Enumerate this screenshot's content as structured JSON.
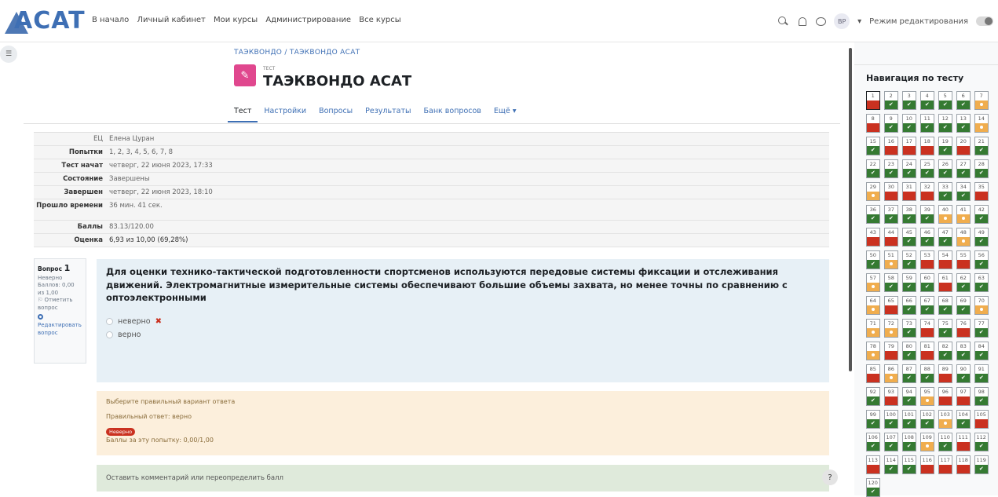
{
  "logo": {
    "text": "ACAT"
  },
  "top_menu": [
    "В начало",
    "Личный кабинет",
    "Мои курсы",
    "Администрирование",
    "Все курсы"
  ],
  "user": {
    "initials": "ВР"
  },
  "edit_mode_label": "Режим редактирования",
  "breadcrumb": "ТАЭКВОНДО / ТАЭКВОНДО АСАТ",
  "quiz": {
    "type_label": "ТЕСТ",
    "title": "ТАЭКВОНДО АСАТ"
  },
  "tabs": [
    "Тест",
    "Настройки",
    "Вопросы",
    "Результаты",
    "Банк вопросов",
    "Ещё ▾"
  ],
  "summary": {
    "user_initials": "ЕЦ",
    "user_name": "Елена Цуран",
    "rows": [
      {
        "label": "Попытки",
        "value": "1, 2, 3, 4, 5, 6, 7, 8"
      },
      {
        "label": "Тест начат",
        "value": "четверг, 22 июня 2023, 17:33"
      },
      {
        "label": "Состояние",
        "value": "Завершены"
      },
      {
        "label": "Завершен",
        "value": "четверг, 22 июня 2023, 18:10"
      },
      {
        "label": "Прошло времени",
        "value": "36 мин. 41 сек."
      },
      {
        "label": "Баллы",
        "value": "83.13/120.00"
      },
      {
        "label": "Оценка",
        "value": "6,93 из 10,00 (69,28%)"
      }
    ]
  },
  "question_info": {
    "prefix": "Вопрос",
    "number": "1",
    "status": "Неверно",
    "points": "Баллов: 0,00 из 1,00",
    "flag": "Отметить вопрос",
    "edit": "Редактировать вопрос"
  },
  "question": {
    "text": "Для оценки технико-тактической подготовленности спортсменов используются передовые системы фиксации и отслеживания движений. Электромагнитные измерительные системы обеспечивают большие объемы захвата, но менее точны по сравнению с оптоэлектронными",
    "options": [
      "неверно",
      "верно"
    ]
  },
  "feedback": {
    "prompt": "Выберите правильный вариант ответа",
    "correct_answer": "Правильный ответ: верно",
    "badge": "Неверно",
    "attempt_points": "Баллы за эту попытку: 0,00/1,00"
  },
  "comment_label": "Оставить комментарий или переопределить балл",
  "help_label": "?",
  "nav": {
    "title": "Навигация по тесту",
    "questions": [
      {
        "n": "1",
        "s": "wrong"
      },
      {
        "n": "2",
        "s": "correct"
      },
      {
        "n": "3",
        "s": "correct"
      },
      {
        "n": "4",
        "s": "correct"
      },
      {
        "n": "5",
        "s": "correct"
      },
      {
        "n": "6",
        "s": "correct"
      },
      {
        "n": "7",
        "s": "partial"
      },
      {
        "n": "8",
        "s": "wrong"
      },
      {
        "n": "9",
        "s": "correct"
      },
      {
        "n": "10",
        "s": "correct"
      },
      {
        "n": "11",
        "s": "correct"
      },
      {
        "n": "12",
        "s": "correct"
      },
      {
        "n": "13",
        "s": "correct"
      },
      {
        "n": "14",
        "s": "partial"
      },
      {
        "n": "15",
        "s": "correct"
      },
      {
        "n": "16",
        "s": "wrong"
      },
      {
        "n": "17",
        "s": "wrong"
      },
      {
        "n": "18",
        "s": "wrong"
      },
      {
        "n": "19",
        "s": "correct"
      },
      {
        "n": "20",
        "s": "wrong"
      },
      {
        "n": "21",
        "s": "correct"
      },
      {
        "n": "22",
        "s": "correct"
      },
      {
        "n": "23",
        "s": "correct"
      },
      {
        "n": "24",
        "s": "correct"
      },
      {
        "n": "25",
        "s": "correct"
      },
      {
        "n": "26",
        "s": "correct"
      },
      {
        "n": "27",
        "s": "correct"
      },
      {
        "n": "28",
        "s": "correct"
      },
      {
        "n": "29",
        "s": "partial"
      },
      {
        "n": "30",
        "s": "wrong"
      },
      {
        "n": "31",
        "s": "wrong"
      },
      {
        "n": "32",
        "s": "wrong"
      },
      {
        "n": "33",
        "s": "correct"
      },
      {
        "n": "34",
        "s": "correct"
      },
      {
        "n": "35",
        "s": "wrong"
      },
      {
        "n": "36",
        "s": "correct"
      },
      {
        "n": "37",
        "s": "correct"
      },
      {
        "n": "38",
        "s": "correct"
      },
      {
        "n": "39",
        "s": "correct"
      },
      {
        "n": "40",
        "s": "partial"
      },
      {
        "n": "41",
        "s": "partial"
      },
      {
        "n": "42",
        "s": "correct"
      },
      {
        "n": "43",
        "s": "wrong"
      },
      {
        "n": "44",
        "s": "wrong"
      },
      {
        "n": "45",
        "s": "correct"
      },
      {
        "n": "46",
        "s": "correct"
      },
      {
        "n": "47",
        "s": "correct"
      },
      {
        "n": "48",
        "s": "partial"
      },
      {
        "n": "49",
        "s": "correct"
      },
      {
        "n": "50",
        "s": "correct"
      },
      {
        "n": "51",
        "s": "partial"
      },
      {
        "n": "52",
        "s": "correct"
      },
      {
        "n": "53",
        "s": "wrong"
      },
      {
        "n": "54",
        "s": "wrong"
      },
      {
        "n": "55",
        "s": "wrong"
      },
      {
        "n": "56",
        "s": "correct"
      },
      {
        "n": "57",
        "s": "partial"
      },
      {
        "n": "58",
        "s": "correct"
      },
      {
        "n": "59",
        "s": "correct"
      },
      {
        "n": "60",
        "s": "correct"
      },
      {
        "n": "61",
        "s": "wrong"
      },
      {
        "n": "62",
        "s": "correct"
      },
      {
        "n": "63",
        "s": "correct"
      },
      {
        "n": "64",
        "s": "partial"
      },
      {
        "n": "65",
        "s": "wrong"
      },
      {
        "n": "66",
        "s": "correct"
      },
      {
        "n": "67",
        "s": "correct"
      },
      {
        "n": "68",
        "s": "correct"
      },
      {
        "n": "69",
        "s": "correct"
      },
      {
        "n": "70",
        "s": "partial"
      },
      {
        "n": "71",
        "s": "partial"
      },
      {
        "n": "72",
        "s": "partial"
      },
      {
        "n": "73",
        "s": "correct"
      },
      {
        "n": "74",
        "s": "wrong"
      },
      {
        "n": "75",
        "s": "correct"
      },
      {
        "n": "76",
        "s": "wrong"
      },
      {
        "n": "77",
        "s": "correct"
      },
      {
        "n": "78",
        "s": "partial"
      },
      {
        "n": "79",
        "s": "wrong"
      },
      {
        "n": "80",
        "s": "correct"
      },
      {
        "n": "81",
        "s": "wrong"
      },
      {
        "n": "82",
        "s": "correct"
      },
      {
        "n": "83",
        "s": "correct"
      },
      {
        "n": "84",
        "s": "correct"
      },
      {
        "n": "85",
        "s": "wrong"
      },
      {
        "n": "86",
        "s": "partial"
      },
      {
        "n": "87",
        "s": "correct"
      },
      {
        "n": "88",
        "s": "correct"
      },
      {
        "n": "89",
        "s": "wrong"
      },
      {
        "n": "90",
        "s": "correct"
      },
      {
        "n": "91",
        "s": "correct"
      },
      {
        "n": "92",
        "s": "correct"
      },
      {
        "n": "93",
        "s": "wrong"
      },
      {
        "n": "94",
        "s": "correct"
      },
      {
        "n": "95",
        "s": "partial"
      },
      {
        "n": "96",
        "s": "wrong"
      },
      {
        "n": "97",
        "s": "wrong"
      },
      {
        "n": "98",
        "s": "correct"
      },
      {
        "n": "99",
        "s": "correct"
      },
      {
        "n": "100",
        "s": "correct"
      },
      {
        "n": "101",
        "s": "correct"
      },
      {
        "n": "102",
        "s": "correct"
      },
      {
        "n": "103",
        "s": "partial"
      },
      {
        "n": "104",
        "s": "correct"
      },
      {
        "n": "105",
        "s": "wrong"
      },
      {
        "n": "106",
        "s": "correct"
      },
      {
        "n": "107",
        "s": "correct"
      },
      {
        "n": "108",
        "s": "correct"
      },
      {
        "n": "109",
        "s": "partial"
      },
      {
        "n": "110",
        "s": "correct"
      },
      {
        "n": "111",
        "s": "wrong"
      },
      {
        "n": "112",
        "s": "correct"
      },
      {
        "n": "113",
        "s": "wrong"
      },
      {
        "n": "114",
        "s": "correct"
      },
      {
        "n": "115",
        "s": "correct"
      },
      {
        "n": "116",
        "s": "wrong"
      },
      {
        "n": "117",
        "s": "wrong"
      },
      {
        "n": "118",
        "s": "wrong"
      },
      {
        "n": "119",
        "s": "correct"
      },
      {
        "n": "120",
        "s": "correct"
      }
    ]
  },
  "colors": {
    "accent": "#3e6fb4",
    "correct": "#357a32",
    "wrong": "#ca3120",
    "partial": "#f0ad4e",
    "quiz_icon": "#e0478e"
  },
  "icons": {
    "search": "search-icon",
    "bell": "bell-icon",
    "chat": "chat-icon",
    "drawer": "drawer-toggle-icon",
    "edit": "gear-icon",
    "flag": "flag-icon",
    "wrong_mark": "cross-icon",
    "correct_mark": "check-icon"
  }
}
